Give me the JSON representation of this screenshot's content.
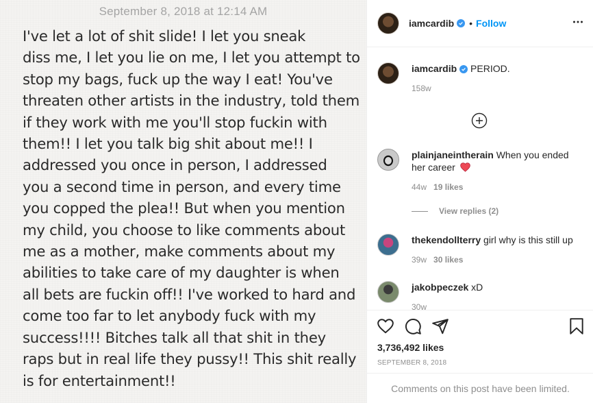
{
  "note": {
    "date": "September 8, 2018 at 12:14 AM",
    "lines": [
      "I've let a lot of shit slide! I let you sneak",
      "diss me, I let you lie on me, I let you attempt to",
      "stop my bags, fuck up the way I eat! You've",
      "threaten other artists in the industry, told them",
      "if they work with me you'll stop fuckin with",
      "them!! I let you talk big shit about me!! I",
      "addressed you once in person, I addressed",
      "you a second time in person, and every time",
      "you copped the plea!! But when you mention",
      "my child, you choose to like comments about",
      "me as a mother, make comments about my",
      "abilities to take care of my daughter is when",
      "all bets are fuckin off!! I've worked to hard and",
      "come too far to let anybody fuck with my",
      "success!!!! Bitches talk all that shit in they",
      "raps but in real life they pussy!! This shit really",
      "is for entertainment!!"
    ]
  },
  "header": {
    "username": "iamcardib",
    "separator": "•",
    "follow_label": "Follow",
    "more_icon": "more-options-icon"
  },
  "caption": {
    "username": "iamcardib",
    "text": "PERIOD.",
    "age": "158w"
  },
  "load_more_icon": "plus-circle-icon",
  "comments": [
    {
      "username": "plainjaneintherain",
      "text": "When you ended her career",
      "emoji": "red-heart",
      "age": "44w",
      "likes": "19 likes"
    },
    {
      "username": "thekendollterry",
      "text": "girl why is this still up",
      "age": "39w",
      "likes": "30 likes"
    },
    {
      "username": "jakobpeczek",
      "text": "xD",
      "age": "30w"
    }
  ],
  "view_replies_label": "View replies (2)",
  "actions": {
    "like_icon": "heart-icon",
    "comment_icon": "comment-icon",
    "share_icon": "share-icon",
    "save_icon": "bookmark-icon"
  },
  "likes_count": "3,736,492 likes",
  "post_date": "SEPTEMBER 8, 2018",
  "comments_limited": "Comments on this post have been limited.",
  "colors": {
    "link_blue": "#0095f6",
    "verified_blue": "#3897f0",
    "muted_gray": "#8e8e8e",
    "heart_red": "#ed4956"
  }
}
